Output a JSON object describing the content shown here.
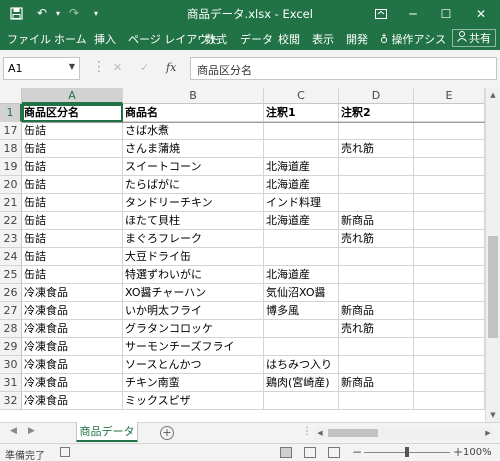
{
  "titlebar": {
    "title": "商品データ.xlsx - Excel",
    "icons": [
      "save-icon",
      "undo-icon",
      "redo-icon",
      "customize-quick-access-icon"
    ],
    "window_controls": [
      "ribbon-display-options-icon",
      "minimize-icon",
      "restore-icon",
      "close-icon"
    ]
  },
  "ribbon": {
    "tabs": [
      "ファイル",
      "ホーム",
      "挿入",
      "ページ レイアウト",
      "数式",
      "データ",
      "校閲",
      "表示",
      "開発"
    ],
    "tell_me": "操作アシス",
    "share": "共有"
  },
  "formula_bar": {
    "name_box": "A1",
    "fx": "fx",
    "content": "商品区分名"
  },
  "columns": [
    "A",
    "B",
    "C",
    "D",
    "E"
  ],
  "header_row": {
    "row": "1",
    "cells": [
      "商品区分名",
      "商品名",
      "注釈1",
      "注釈2",
      ""
    ]
  },
  "rows": [
    {
      "row": "17",
      "cells": [
        "缶詰",
        "さば水煮",
        "",
        "",
        ""
      ]
    },
    {
      "row": "18",
      "cells": [
        "缶詰",
        "さんま蒲焼",
        "",
        "売れ筋",
        ""
      ]
    },
    {
      "row": "19",
      "cells": [
        "缶詰",
        "スイートコーン",
        "北海道産",
        "",
        ""
      ]
    },
    {
      "row": "20",
      "cells": [
        "缶詰",
        "たらばがに",
        "北海道産",
        "",
        ""
      ]
    },
    {
      "row": "21",
      "cells": [
        "缶詰",
        "タンドリーチキン",
        "インド料理",
        "",
        ""
      ]
    },
    {
      "row": "22",
      "cells": [
        "缶詰",
        "ほたて貝柱",
        "北海道産",
        "新商品",
        ""
      ]
    },
    {
      "row": "23",
      "cells": [
        "缶詰",
        "まぐろフレーク",
        "",
        "売れ筋",
        ""
      ]
    },
    {
      "row": "24",
      "cells": [
        "缶詰",
        "大豆ドライ缶",
        "",
        "",
        ""
      ]
    },
    {
      "row": "25",
      "cells": [
        "缶詰",
        "特選ずわいがに",
        "北海道産",
        "",
        ""
      ]
    },
    {
      "row": "26",
      "cells": [
        "冷凍食品",
        "XO醤チャーハン",
        "気仙沼XO醤",
        "",
        ""
      ]
    },
    {
      "row": "27",
      "cells": [
        "冷凍食品",
        "いか明太フライ",
        "博多風",
        "新商品",
        ""
      ]
    },
    {
      "row": "28",
      "cells": [
        "冷凍食品",
        "グラタンコロッケ",
        "",
        "売れ筋",
        ""
      ]
    },
    {
      "row": "29",
      "cells": [
        "冷凍食品",
        "サーモンチーズフライ",
        "",
        "",
        ""
      ]
    },
    {
      "row": "30",
      "cells": [
        "冷凍食品",
        "ソースとんかつ",
        "はちみつ入り",
        "",
        ""
      ]
    },
    {
      "row": "31",
      "cells": [
        "冷凍食品",
        "チキン南蛮",
        "鶏肉(宮崎産)",
        "新商品",
        ""
      ]
    },
    {
      "row": "32",
      "cells": [
        "冷凍食品",
        "ミックスピザ",
        "",
        "",
        ""
      ]
    }
  ],
  "sheet_tabs": [
    "商品データ"
  ],
  "status": {
    "ready": "準備完了",
    "zoom": "100%"
  },
  "colors": {
    "excel_green": "#217346",
    "grid_line": "#d4d4d4",
    "header_bg": "#f3f3f3"
  }
}
